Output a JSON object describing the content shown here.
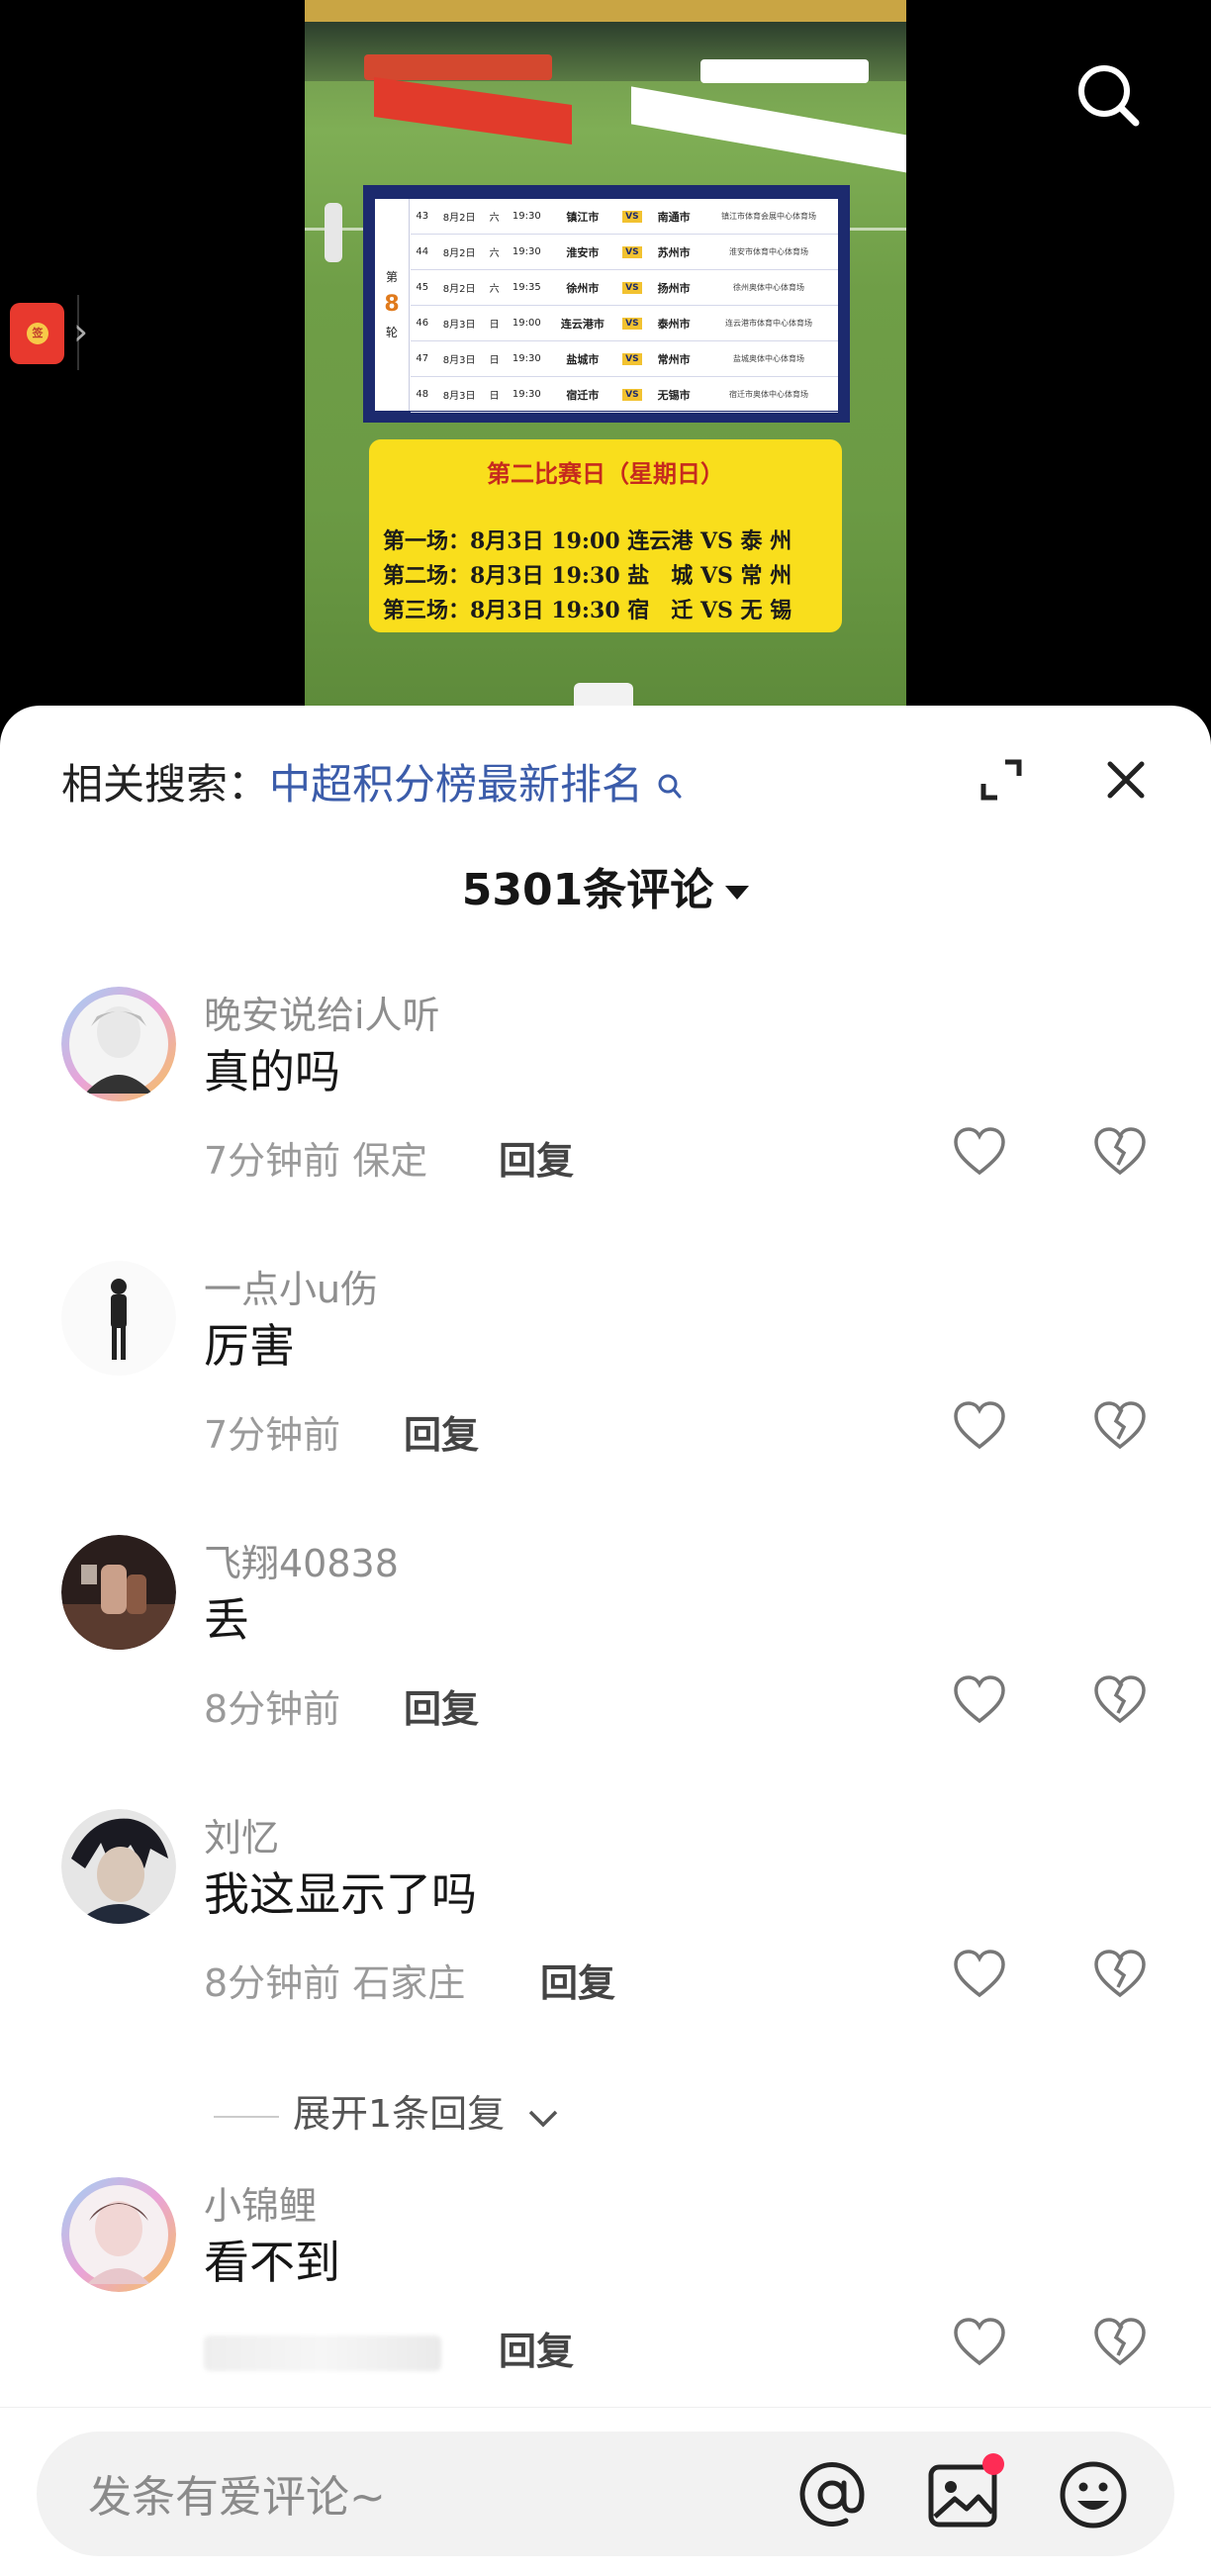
{
  "video": {
    "round_label_top": "第",
    "round_number": "8",
    "round_label_bottom": "轮",
    "schedule": [
      {
        "no": "43",
        "date": "8月2日",
        "day": "六",
        "time": "19:30",
        "home": "镇江市",
        "vs": "VS",
        "away": "南通市",
        "venue": "镇江市体育会展中心体育场"
      },
      {
        "no": "44",
        "date": "8月2日",
        "day": "六",
        "time": "19:30",
        "home": "淮安市",
        "vs": "VS",
        "away": "苏州市",
        "venue": "淮安市体育中心体育场"
      },
      {
        "no": "45",
        "date": "8月2日",
        "day": "六",
        "time": "19:35",
        "home": "徐州市",
        "vs": "VS",
        "away": "扬州市",
        "venue": "徐州奥体中心体育场"
      },
      {
        "no": "46",
        "date": "8月3日",
        "day": "日",
        "time": "19:00",
        "home": "连云港市",
        "vs": "VS",
        "away": "泰州市",
        "venue": "连云港市体育中心体育场"
      },
      {
        "no": "47",
        "date": "8月3日",
        "day": "日",
        "time": "19:30",
        "home": "盐城市",
        "vs": "VS",
        "away": "常州市",
        "venue": "盐城奥体中心体育场"
      },
      {
        "no": "48",
        "date": "8月3日",
        "day": "日",
        "time": "19:30",
        "home": "宿迁市",
        "vs": "VS",
        "away": "无锡市",
        "venue": "宿迁市奥体中心体育场"
      }
    ],
    "matchday_title": "第二比赛日（星期日）",
    "matchday_lines": [
      "第一场：8月3日 19:00 连云港 VS 泰 州",
      "第二场：8月3日 19:30 盐　城 VS 常 州",
      "第三场：8月3日 19:30 宿　迁 VS 无 锡"
    ],
    "redpacket_seal": "签"
  },
  "sheet": {
    "related_label": "相关搜索：",
    "related_term": "中超积分榜最新排名",
    "comment_count": "5301条评论",
    "comments": [
      {
        "user": "晚安说给i人听",
        "text": "真的吗",
        "time_loc": "7分钟前 保定",
        "reply": "回复"
      },
      {
        "user": "一点小u伤",
        "text": "厉害",
        "time_loc": "7分钟前",
        "reply": "回复"
      },
      {
        "user": "飞翔40838",
        "text": "丢",
        "time_loc": "8分钟前",
        "reply": "回复"
      },
      {
        "user": "刘忆",
        "text": "我这显示了吗",
        "time_loc": "8分钟前 石家庄",
        "reply": "回复"
      },
      {
        "user": "小锦鲤",
        "text": "看不到",
        "time_loc": "",
        "reply": "回复"
      }
    ],
    "expand_replies": "展开1条回复"
  },
  "input": {
    "placeholder": "发条有爱评论~"
  },
  "colors": {
    "accent_link": "#3b5caa",
    "notification_dot": "#fe2c55",
    "matchday_bg": "#f9de1c"
  }
}
